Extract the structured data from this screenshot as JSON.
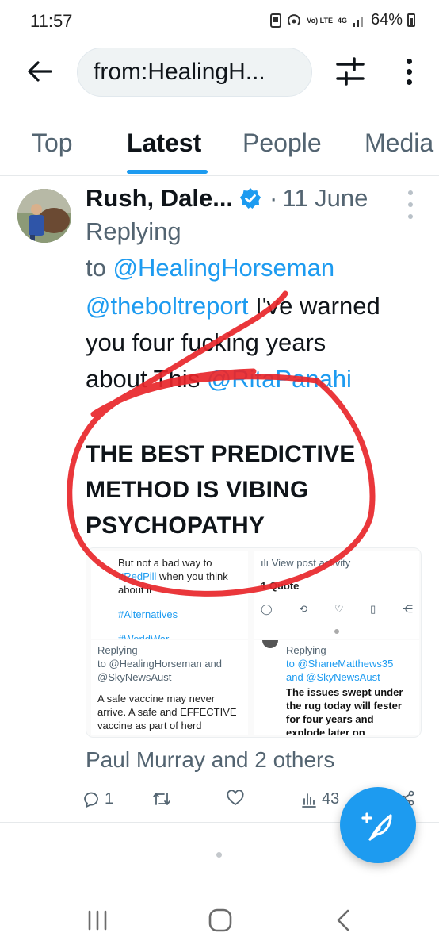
{
  "status_bar": {
    "time": "11:57",
    "network_label": "4G",
    "volte_label": "Vo) LTE",
    "battery_percent": "64%"
  },
  "header": {
    "search_value": "from:HealingH...",
    "icons": [
      "arrow-left-icon",
      "filter-sliders-icon",
      "more-vertical-icon"
    ]
  },
  "tabs": [
    {
      "label": "Top",
      "active": false
    },
    {
      "label": "Latest",
      "active": true
    },
    {
      "label": "People",
      "active": false
    },
    {
      "label": "Media",
      "active": false
    }
  ],
  "tweet": {
    "author": "Rush, Dale...",
    "date": "11 June",
    "reply_prefix_1": "Replying",
    "reply_prefix_2": "to ",
    "reply_to": "@HealingHorseman",
    "body_mention_1": "@theboltreport",
    "body_text_1": " I've warned",
    "body_text_2": "you four fucking years",
    "body_text_3": "about This ",
    "body_mention_2": "@RitaPanahi",
    "headline_line_1": "THE BEST PREDICTIVE",
    "headline_line_2": "METHOD IS VIBING",
    "headline_line_3": "PSYCHOPATHY",
    "image": {
      "panel1_line1": "But not a bad way to",
      "panel1_tag1": "#RedPill",
      "panel1_line2": " when you think",
      "panel1_line3": "about it",
      "panel1_tag2": "#Alternatives",
      "panel1_tag3": "#WorldWar",
      "panel2_activity": "View post activity",
      "panel2_quote": "1 Quote",
      "panel3_replying": "Replying",
      "panel3_to": "to @HealingHorseman and",
      "panel3_to2": "@SkyNewsAust",
      "panel3_body": "A safe vaccine may never arrive. A safe and EFFECTIVE vaccine as part of herd immunity, may never arrive.",
      "panel4_replying": "Replying",
      "panel4_to": "to @ShaneMatthews35",
      "panel4_to2": "and @SkyNewsAust",
      "panel4_body": "The issues swept under the rug today will fester for four years and explode later on."
    },
    "liked_by": "Paul Murray and 2 others",
    "reply_count": "1",
    "views_count": "43",
    "icons": [
      "verified-badge-icon",
      "reply-icon",
      "retweet-icon",
      "like-icon",
      "views-icon",
      "share-icon"
    ]
  },
  "annotation_color": "#e8262a",
  "accent_color": "#1d9bf0"
}
